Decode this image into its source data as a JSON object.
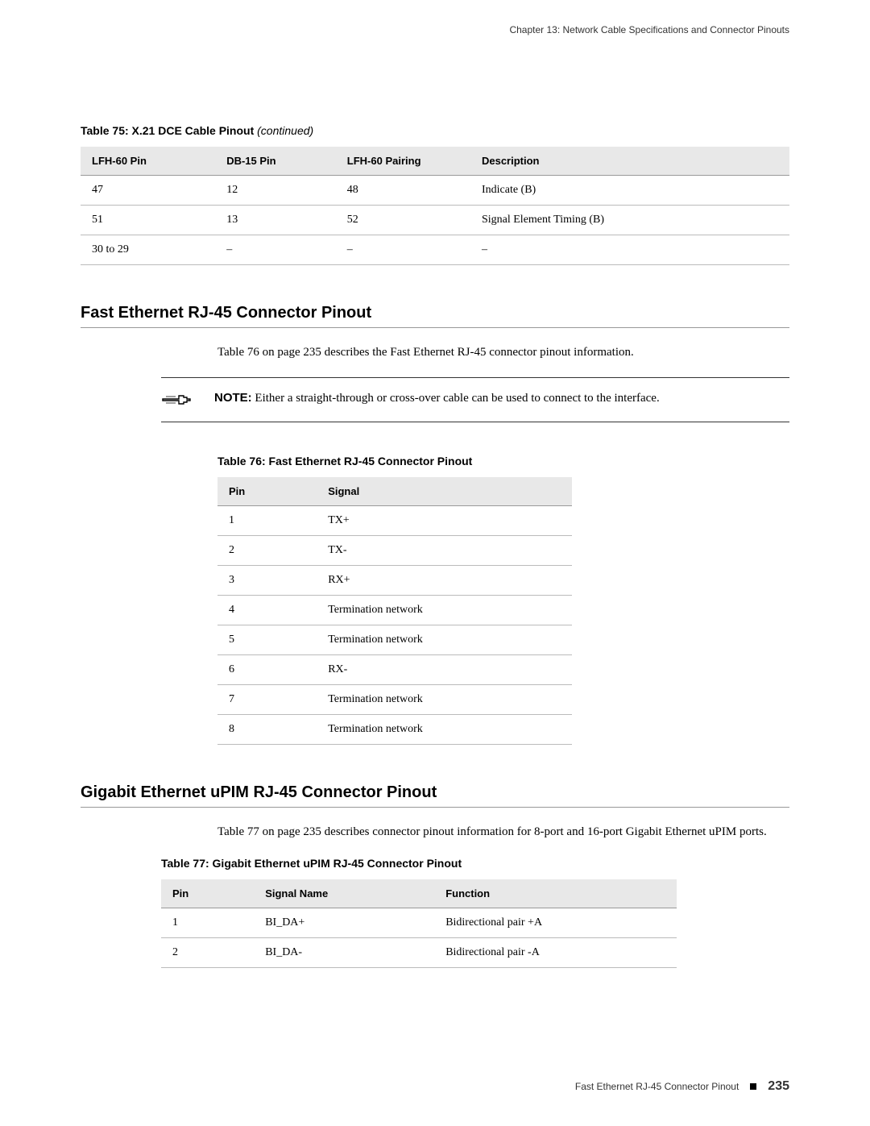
{
  "header": {
    "chapter_line": "Chapter 13: Network Cable Specifications and Connector Pinouts"
  },
  "table75": {
    "title_prefix": "Table 75: X.21 DCE Cable Pinout",
    "continued": " (continued)",
    "headers": [
      "LFH-60 Pin",
      "DB-15 Pin",
      "LFH-60 Pairing",
      "Description"
    ],
    "rows": [
      [
        "47",
        "12",
        "48",
        "Indicate (B)"
      ],
      [
        "51",
        "13",
        "52",
        "Signal Element Timing (B)"
      ],
      [
        "30 to 29",
        "–",
        "–",
        "–"
      ]
    ]
  },
  "section1": {
    "heading": "Fast Ethernet RJ-45 Connector Pinout",
    "intro": "Table 76 on page 235 describes the Fast Ethernet RJ-45 connector pinout information.",
    "note_bold": "NOTE:",
    "note_text": " Either a straight-through or cross-over cable can be used to connect to the interface."
  },
  "table76": {
    "title": "Table 76: Fast Ethernet RJ-45 Connector Pinout",
    "headers": [
      "Pin",
      "Signal"
    ],
    "rows": [
      [
        "1",
        "TX+"
      ],
      [
        "2",
        "TX-"
      ],
      [
        "3",
        "RX+"
      ],
      [
        "4",
        "Termination network"
      ],
      [
        "5",
        "Termination network"
      ],
      [
        "6",
        "RX-"
      ],
      [
        "7",
        "Termination network"
      ],
      [
        "8",
        "Termination network"
      ]
    ]
  },
  "section2": {
    "heading": "Gigabit Ethernet uPIM RJ-45 Connector Pinout",
    "intro": "Table 77 on page 235 describes connector pinout information for 8-port and 16-port Gigabit Ethernet uPIM ports."
  },
  "table77": {
    "title": "Table 77: Gigabit Ethernet uPIM RJ-45 Connector Pinout",
    "headers": [
      "Pin",
      "Signal Name",
      "Function"
    ],
    "rows": [
      [
        "1",
        "BI_DA+",
        "Bidirectional pair +A"
      ],
      [
        "2",
        "BI_DA-",
        "Bidirectional pair -A"
      ]
    ]
  },
  "footer": {
    "label": "Fast Ethernet RJ-45 Connector Pinout",
    "page": "235"
  }
}
